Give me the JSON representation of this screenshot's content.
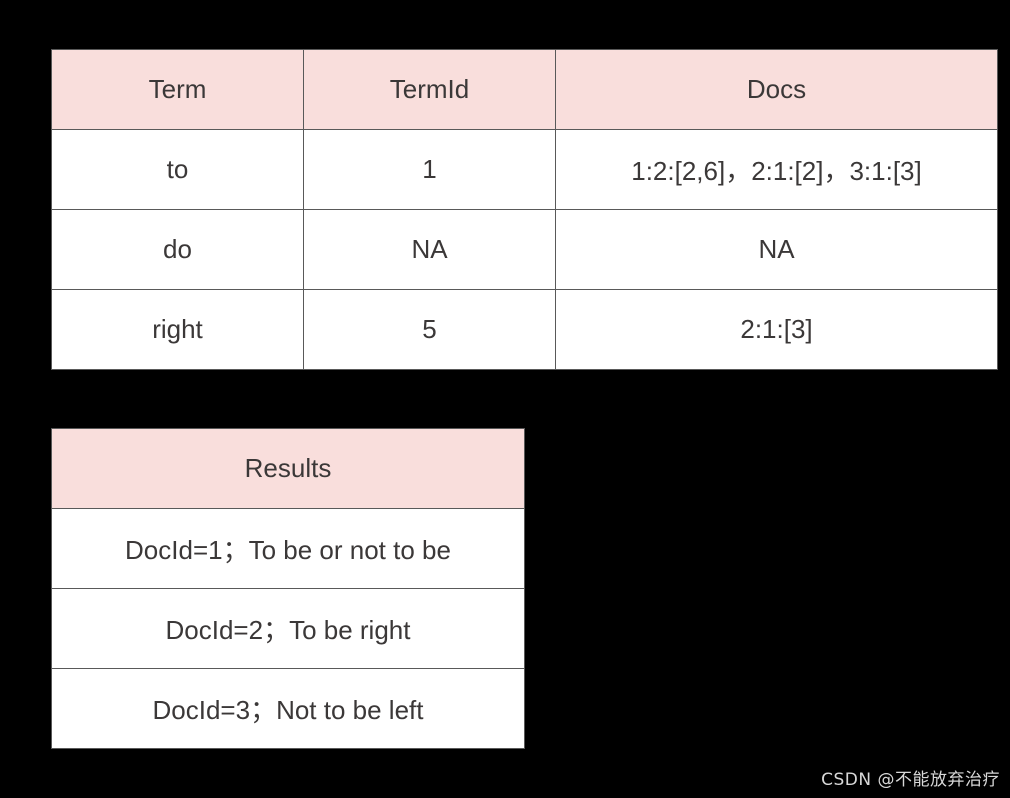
{
  "background_color": "#000000",
  "theme": {
    "header_fill": "#f9dedc",
    "cell_fill": "#ffffff",
    "border_color": "#595959",
    "text_color": "#3b3838",
    "watermark_color": "#d8d8d8"
  },
  "index_table": {
    "name": "inverted-index-table",
    "columns": [
      "Term",
      "TermId",
      "Docs"
    ],
    "rows": [
      {
        "term": "to",
        "term_id": "1",
        "docs": "1:2:[2,6]，2:1:[2]，3:1:[3]"
      },
      {
        "term": "do",
        "term_id": "NA",
        "docs": "NA"
      },
      {
        "term": "right",
        "term_id": "5",
        "docs": "2:1:[3]"
      }
    ]
  },
  "results_table": {
    "name": "results-table",
    "header": "Results",
    "rows": [
      {
        "text": "DocId=1；To be or not to be"
      },
      {
        "text": "DocId=2；To be right"
      },
      {
        "text": "DocId=3；Not to be left"
      }
    ]
  },
  "watermark": {
    "text": "CSDN @不能放弃治疗"
  }
}
